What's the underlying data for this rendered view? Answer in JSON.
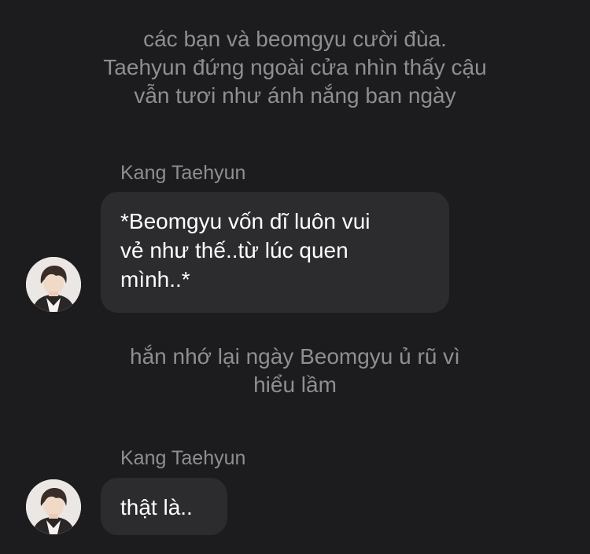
{
  "chat": {
    "narration_1": "các bạn và beomgyu cười đùa.\nTaehyun đứng ngoài cửa nhìn thấy cậu\nvẫn tươi như ánh nắng ban ngày",
    "messages": [
      {
        "sender": "Kang Taehyun",
        "text": "*Beomgyu vốn dĩ luôn vui\nvẻ như thế..từ lúc quen\nmình..*",
        "avatar_icon": "profile-photo"
      },
      {
        "sender": "Kang Taehyun",
        "text": "thật là..",
        "avatar_icon": "profile-photo"
      }
    ],
    "narration_2": "hắn nhớ lại ngày Beomgyu ủ rũ vì\nhiểu lầm"
  },
  "colors": {
    "background": "#1c1c1e",
    "bubble": "#2c2c2e",
    "secondary_text": "#8e8e93",
    "primary_text": "#ffffff"
  }
}
